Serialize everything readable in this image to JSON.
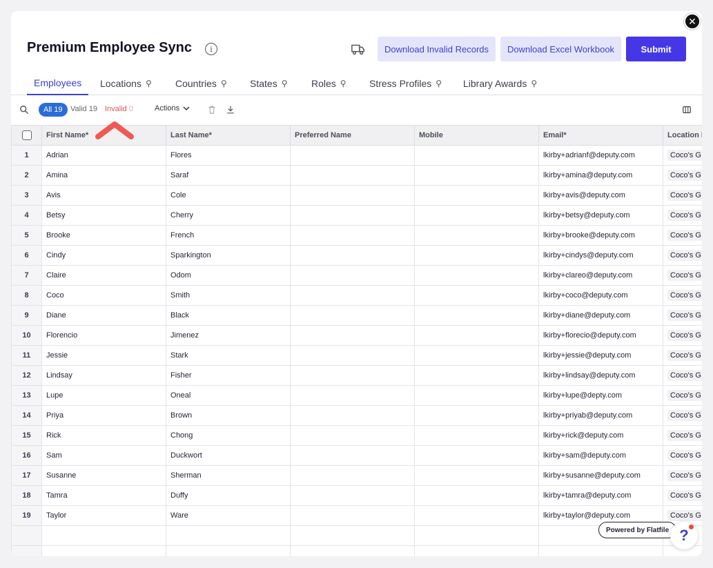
{
  "header": {
    "title": "Premium Employee Sync",
    "info_glyph": "i",
    "download_invalid_label": "Download Invalid Records",
    "download_excel_label": "Download Excel Workbook",
    "submit_label": "Submit",
    "close_glyph": "✕"
  },
  "tabs": [
    {
      "label": "Employees",
      "active": true
    },
    {
      "label": "Locations"
    },
    {
      "label": "Countries"
    },
    {
      "label": "States"
    },
    {
      "label": "Roles"
    },
    {
      "label": "Stress Profiles"
    },
    {
      "label": "Library Awards"
    }
  ],
  "toolbar": {
    "all_label": "All",
    "all_count": "19",
    "valid_label": "Valid",
    "valid_count": "19",
    "invalid_label": "Invalid",
    "invalid_count": "0",
    "actions_label": "Actions"
  },
  "columns": [
    "First Name*",
    "Last Name*",
    "Preferred Name",
    "Mobile",
    "Email*",
    "Location I"
  ],
  "rows": [
    {
      "n": "1",
      "first": "Adrian",
      "last": "Flores",
      "email": "lkirby+adrianf@deputy.com",
      "loc": "Coco's G"
    },
    {
      "n": "2",
      "first": "Amina",
      "last": "Saraf",
      "email": "lkirby+amina@deputy.com",
      "loc": "Coco's G"
    },
    {
      "n": "3",
      "first": "Avis",
      "last": "Cole",
      "email": "lkirby+avis@deputy.com",
      "loc": "Coco's G"
    },
    {
      "n": "4",
      "first": "Betsy",
      "last": "Cherry",
      "email": "lkirby+betsy@deputy.com",
      "loc": "Coco's G"
    },
    {
      "n": "5",
      "first": "Brooke",
      "last": "French",
      "email": "lkirby+brooke@deputy.com",
      "loc": "Coco's G"
    },
    {
      "n": "6",
      "first": "Cindy",
      "last": "Sparkington",
      "email": "lkirby+cindys@deputy.com",
      "loc": "Coco's G"
    },
    {
      "n": "7",
      "first": "Claire",
      "last": "Odom",
      "email": "lkirby+clareo@deputy.com",
      "loc": "Coco's G"
    },
    {
      "n": "8",
      "first": "Coco",
      "last": "Smith",
      "email": "lkirby+coco@deputy.com",
      "loc": "Coco's G"
    },
    {
      "n": "9",
      "first": "Diane",
      "last": "Black",
      "email": "lkirby+diane@deputy.com",
      "loc": "Coco's G"
    },
    {
      "n": "10",
      "first": "Florencio",
      "last": "Jimenez",
      "email": "lkirby+florecio@deputy.com",
      "loc": "Coco's G"
    },
    {
      "n": "11",
      "first": "Jessie",
      "last": "Stark",
      "email": "lkirby+jessie@deputy.com",
      "loc": "Coco's G"
    },
    {
      "n": "12",
      "first": "Lindsay",
      "last": "Fisher",
      "email": "lkirby+lindsay@deputy.com",
      "loc": "Coco's G"
    },
    {
      "n": "13",
      "first": "Lupe",
      "last": "Oneal",
      "email": "lkirby+lupe@depty.com",
      "loc": "Coco's G"
    },
    {
      "n": "14",
      "first": "Priya",
      "last": "Brown",
      "email": "lkirby+priyab@deputy.com",
      "loc": "Coco's G"
    },
    {
      "n": "15",
      "first": "Rick",
      "last": "Chong",
      "email": "lkirby+rick@deputy.com",
      "loc": "Coco's G"
    },
    {
      "n": "16",
      "first": "Sam",
      "last": "Duckwort",
      "email": "lkirby+sam@deputy.com",
      "loc": "Coco's G"
    },
    {
      "n": "17",
      "first": "Susanne",
      "last": "Sherman",
      "email": "lkirby+susanne@deputy.com",
      "loc": "Coco's G"
    },
    {
      "n": "18",
      "first": "Tamra",
      "last": "Duffy",
      "email": "lkirby+tamra@deputy.com",
      "loc": "Coco's G"
    },
    {
      "n": "19",
      "first": "Taylor",
      "last": "Ware",
      "email": "lkirby+taylor@deputy.com",
      "loc": "Coco's G"
    }
  ],
  "footer": {
    "powered_label": "Powered by Flatfile",
    "help_glyph": "?"
  },
  "colors": {
    "primary": "#4537e6",
    "accent_text": "#3f3fc8",
    "invalid_red": "#d9534f",
    "annotation_arrow": "#ee5a52"
  }
}
